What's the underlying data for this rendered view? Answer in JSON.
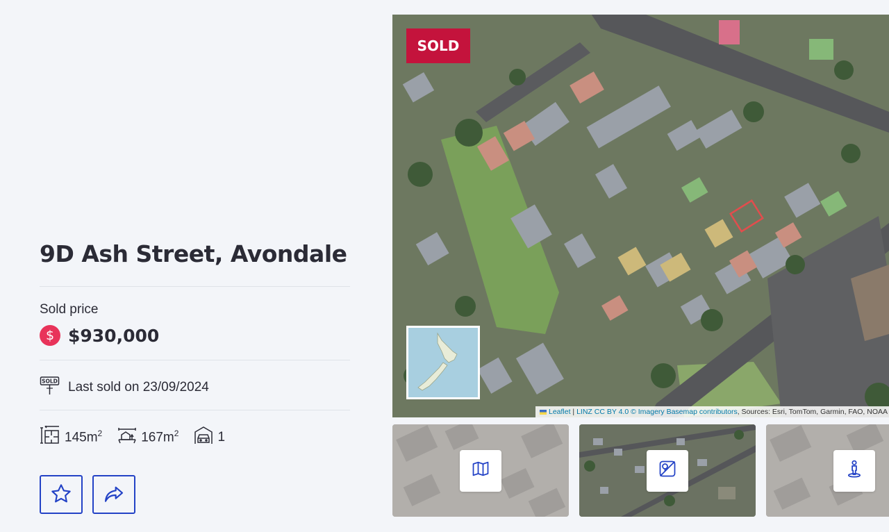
{
  "property": {
    "address": "9D Ash Street, Avondale",
    "sold_price_label": "Sold price",
    "sold_price": "$930,000",
    "price_icon_symbol": "$",
    "last_sold": "Last sold on 23/09/2024",
    "floor_area_value": "145m",
    "land_area_value": "167m",
    "area_exponent": "2",
    "garage_count": "1"
  },
  "map": {
    "badge": "SOLD",
    "attribution": {
      "leaflet": "Leaflet",
      "separator": " | ",
      "linz": "LINZ CC BY 4.0 © Imagery Basemap contributors",
      "sources": ", Sources: Esri, TomTom, Garmin, FAO, NOAA"
    }
  },
  "icons": {
    "dollar": "dollar-icon",
    "sold_sign": "sold-sign-icon",
    "floor_area": "floor-area-icon",
    "land_area": "land-area-icon",
    "garage": "garage-icon",
    "favourite": "star-icon",
    "share": "share-arrow-icon",
    "map_view": "map-icon",
    "satellite_view": "satellite-icon",
    "street_view": "street-view-icon"
  },
  "colors": {
    "accent": "#2342c6",
    "sold_badge": "#c4133c",
    "price_icon": "#e8335a",
    "background": "#f3f5f9"
  }
}
